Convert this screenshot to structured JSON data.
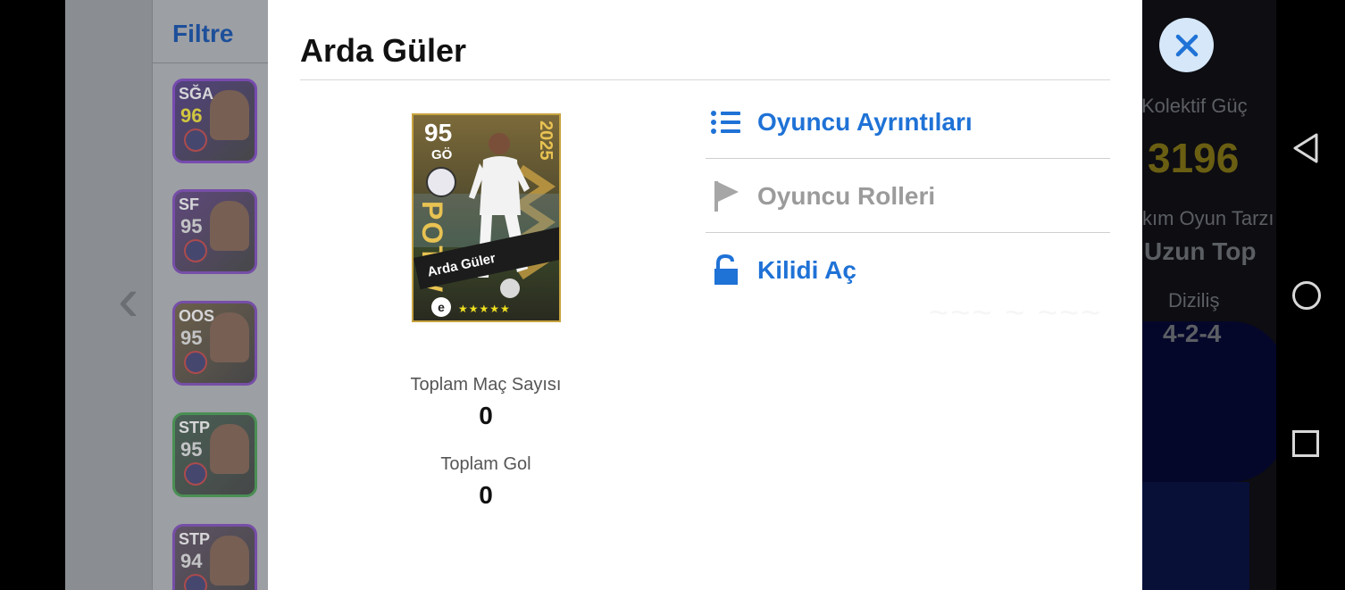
{
  "filter": {
    "title": "Filtre"
  },
  "side_cards": [
    {
      "pos": "SĞA",
      "rating": "96",
      "rating_color": "#e3d21f",
      "border": "#6b2fb3",
      "bg": "#3a2470"
    },
    {
      "pos": "SF",
      "rating": "95",
      "rating_color": "#cfcfcf",
      "border": "#6a34a8",
      "bg": "#4a2d6e"
    },
    {
      "pos": "OOS",
      "rating": "95",
      "rating_color": "#cfcfcf",
      "border": "#6a34a8",
      "bg": "#5c4a2e"
    },
    {
      "pos": "STP",
      "rating": "95",
      "rating_color": "#cfcfcf",
      "border": "#2f8a3a",
      "bg": "#2d4a3a"
    },
    {
      "pos": "STP",
      "rating": "94",
      "rating_color": "#cfcfcf",
      "border": "#6a34a8",
      "bg": "#4a3a4e"
    }
  ],
  "team_panel": {
    "strength_label": "Kolektif Güç",
    "strength_value": "3196",
    "style_label": "kım Oyun Tarzı",
    "style_value": "Uzun Top",
    "formation_label": "Diziliş",
    "formation_value": "4-2-4"
  },
  "modal": {
    "title": "Arda Güler",
    "card": {
      "rating": "95",
      "position": "GÖ",
      "year": "2025",
      "tag": "POTW",
      "name": "Arda Güler",
      "stars": "★★★★★"
    },
    "stats": [
      {
        "label": "Toplam Maç Sayısı",
        "value": "0"
      },
      {
        "label": "Toplam Gol",
        "value": "0"
      }
    ],
    "menu": [
      {
        "label": "Oyuncu Ayrıntıları",
        "icon": "list-icon",
        "color": "#1f72d6",
        "enabled": true
      },
      {
        "label": "Oyuncu Rolleri",
        "icon": "flag-icon",
        "color": "#9b9b9b",
        "enabled": false
      },
      {
        "label": "Kilidi Aç",
        "icon": "unlock-icon",
        "color": "#1f72d6",
        "enabled": true
      }
    ]
  },
  "colors": {
    "accent": "#1f72d6",
    "close_bg": "#d5e7f8",
    "gold": "#e8c252"
  }
}
